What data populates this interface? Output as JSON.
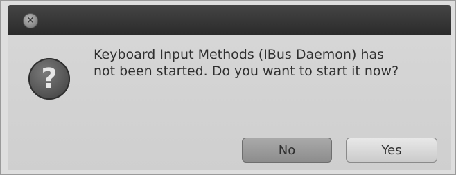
{
  "window": {
    "close_glyph": "×"
  },
  "dialog": {
    "icon": "question-icon",
    "icon_glyph": "?",
    "message_line1": "Keyboard Input Methods (IBus Daemon) has",
    "message_line2": "not been started. Do you want to start it now?"
  },
  "buttons": {
    "no_label": "No",
    "yes_label": "Yes"
  },
  "colors": {
    "titlebar": "#2f2f2f",
    "body": "#d4d4d4",
    "no_button": "#9a9a9a",
    "yes_button": "#d8d8d8"
  }
}
